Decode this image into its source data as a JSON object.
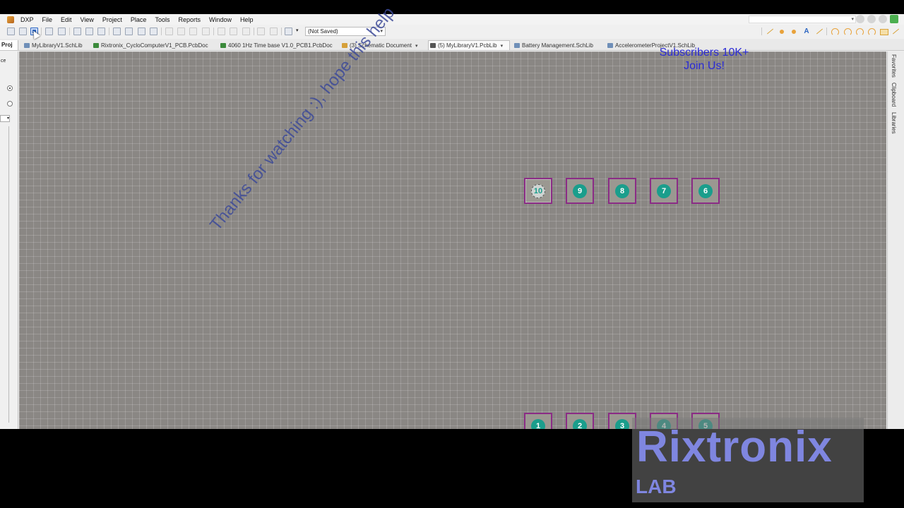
{
  "menu": {
    "items": [
      "DXP",
      "File",
      "Edit",
      "View",
      "Project",
      "Place",
      "Tools",
      "Reports",
      "Window",
      "Help"
    ]
  },
  "toolbar": {
    "variant_value": "(Not Saved)"
  },
  "left_panel": {
    "tab_label": "Proj",
    "cut_label": "ce"
  },
  "doc_tabs": [
    {
      "label": "MyLibraryV1.SchLib",
      "kind": "sch"
    },
    {
      "label": "Rixtronix_CycloComputerV1_PCB.PcbDoc",
      "kind": "pcb"
    },
    {
      "label": "4060 1Hz Time base V1.0_PCB1.PcbDoc",
      "kind": "pcb"
    },
    {
      "label": "(3) Schematic Document",
      "kind": "doc"
    },
    {
      "label": "(5) MyLibraryV1.PcbLib",
      "kind": "lib",
      "active": true
    },
    {
      "label": "Battery Management.SchLib",
      "kind": "sch"
    },
    {
      "label": "AccelerometerProjectV1.SchLib",
      "kind": "sch"
    }
  ],
  "right_panel": {
    "tabs": [
      "Favorites",
      "Clipboard",
      "Libraries"
    ]
  },
  "pads": {
    "top": [
      "10",
      "9",
      "8",
      "7",
      "6"
    ],
    "bottom": [
      "1",
      "2",
      "3",
      "4",
      "5"
    ],
    "selected": "10"
  },
  "overlay": {
    "watermark": "Thanks for watching :), hope this help",
    "subscribers_line1": "Subscribers 10K+",
    "subscribers_line2": "Join Us!",
    "brand_name": "Rixtronix",
    "brand_sub": "LAB"
  },
  "colors": {
    "canvas": "#8a8784",
    "pad_border": "#8b2c86",
    "pad_hole": "#1a9e8c",
    "watermark": "#3d4a98",
    "promo_text": "#2a2ad6",
    "brand": "#7f86e0"
  }
}
